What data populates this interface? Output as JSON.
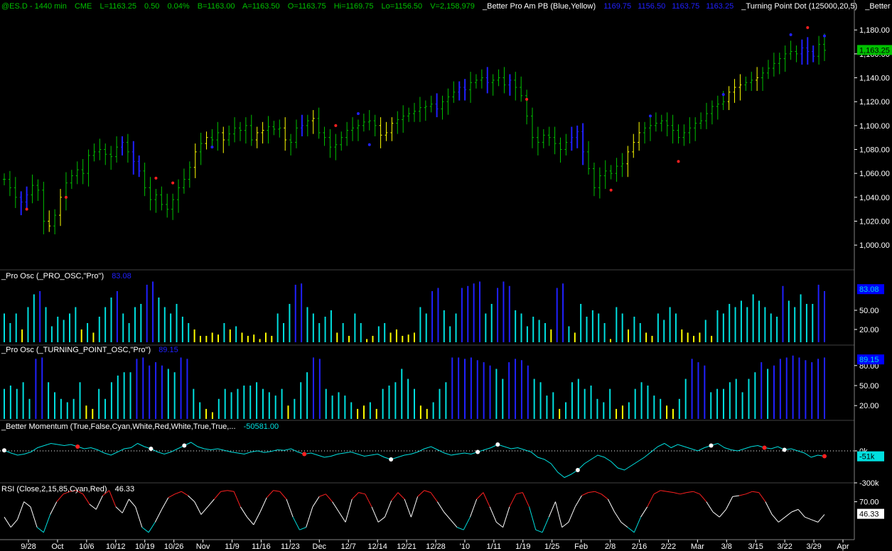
{
  "header": {
    "symbol": "@ES.D - 1440 min",
    "exchange": "CME",
    "last": "L=1163.25",
    "change": "0.50",
    "change_pct": "0.04%",
    "bid": "B=1163.00",
    "ask": "A=1163.50",
    "open": "O=1163.75",
    "high": "Hi=1169.75",
    "low": "Lo=1156.50",
    "volume": "V=2,158,979",
    "study1_name": "_Better Pro Am PB (Blue,Yellow)",
    "study1_values": [
      "1169.75",
      "1156.50",
      "1163.75",
      "1163.25"
    ],
    "study2_name": "_Turning Point Dot (125000,20,5)",
    "study3_name": "_Better Volum"
  },
  "panels": {
    "pro_osc_label": "_Pro Osc (_PRO_OSC,\"Pro\")",
    "pro_osc_value": "83.08",
    "tp_osc_label": "_Pro Osc (_TURNING_POINT_OSC,\"Pro\")",
    "tp_osc_value": "89.15",
    "momentum_label": "_Better Momentum (True,False,Cyan,White,Red,White,True,True,...",
    "momentum_value": "-50581.00",
    "rsi_label": "RSI (Close,2,15,85,Cyan,Red)",
    "rsi_value": "46.33"
  },
  "price_axis": {
    "ticks": [
      "1,180.00",
      "1,160.00",
      "1,140.00",
      "1,120.00",
      "1,100.00",
      "1,080.00",
      "1,060.00",
      "1,040.00",
      "1,020.00",
      "1,000.00"
    ],
    "last_tag": "1,163.25",
    "pro_ticks": [
      "50.00",
      "20.00"
    ],
    "pro_tag": "83.08",
    "tp_ticks": [
      "80.00",
      "50.00",
      "20.00"
    ],
    "tp_tag": "89.15",
    "mom_ticks": [
      "0k",
      "-300k"
    ],
    "mom_tag": "-51k",
    "rsi_ticks": [
      "70.00"
    ],
    "rsi_tag": "46.33"
  },
  "x_axis": {
    "labels": [
      "9/28",
      "Oct",
      "10/6",
      "10/12",
      "10/19",
      "10/26",
      "Nov",
      "11/9",
      "11/16",
      "11/23",
      "Dec",
      "12/7",
      "12/14",
      "12/21",
      "12/28",
      "'10",
      "1/11",
      "1/19",
      "1/25",
      "Feb",
      "2/8",
      "2/16",
      "2/22",
      "Mar",
      "3/8",
      "3/15",
      "3/22",
      "3/29",
      "Apr"
    ]
  },
  "colors": {
    "background": "#000000",
    "up_bar": "#00c000",
    "pro_bar": "#2020ff",
    "pullback_bar": "#ffff00",
    "dot_red": "#ff2020",
    "dot_blue": "#2020ff",
    "cyan": "#00e0e0",
    "white": "#ffffff",
    "red": "#ff2020",
    "axis_text": "#ffffff",
    "tag_green": "#00c000",
    "tag_blue": "#0000ff",
    "tag_cyan": "#00e0e0"
  },
  "chart_data": {
    "type": "bar",
    "price_range": [
      990,
      1192
    ],
    "closes": [
      1055,
      1048,
      1040,
      1036,
      1042,
      1050,
      1046,
      1020,
      1016,
      1025,
      1040,
      1052,
      1058,
      1063,
      1060,
      1075,
      1078,
      1080,
      1076,
      1074,
      1082,
      1086,
      1078,
      1070,
      1062,
      1048,
      1038,
      1042,
      1034,
      1030,
      1038,
      1048,
      1055,
      1065,
      1078,
      1085,
      1090,
      1088,
      1094,
      1088,
      1093,
      1098,
      1096,
      1100,
      1088,
      1094,
      1096,
      1099,
      1097,
      1098,
      1088,
      1086,
      1098,
      1100,
      1104,
      1106,
      1094,
      1090,
      1082,
      1084,
      1090,
      1096,
      1098,
      1100,
      1103,
      1104,
      1100,
      1092,
      1094,
      1102,
      1105,
      1108,
      1110,
      1112,
      1115,
      1116,
      1118,
      1114,
      1120,
      1124,
      1128,
      1132,
      1130,
      1136,
      1138,
      1140,
      1136,
      1138,
      1140,
      1134,
      1138,
      1132,
      1125,
      1108,
      1090,
      1086,
      1092,
      1090,
      1085,
      1080,
      1086,
      1090,
      1095,
      1078,
      1064,
      1048,
      1058,
      1062,
      1060,
      1066,
      1068,
      1078,
      1086,
      1094,
      1098,
      1100,
      1102,
      1104,
      1100,
      1096,
      1090,
      1094,
      1098,
      1102,
      1104,
      1110,
      1116,
      1118,
      1120,
      1128,
      1132,
      1134,
      1136,
      1138,
      1140,
      1144,
      1148,
      1152,
      1156,
      1160,
      1162,
      1160,
      1165,
      1162,
      1158,
      1168,
      1163
    ],
    "bar_colors": "gggbbgggygyggggggggggbgbbgggggggggygyggygggggyygggyggbgygggggggggggyyygggggggbgggbbgggbgggbggggggggggbbbgggggggyyygggggggggggggggyyyggygggggggbbb",
    "pro_osc": [
      45,
      30,
      45,
      20,
      55,
      75,
      80,
      55,
      25,
      40,
      35,
      45,
      55,
      20,
      30,
      15,
      40,
      55,
      70,
      80,
      45,
      30,
      55,
      60,
      90,
      95,
      70,
      55,
      45,
      60,
      40,
      30,
      20,
      10,
      10,
      15,
      12,
      30,
      20,
      25,
      15,
      10,
      12,
      5,
      15,
      10,
      45,
      30,
      60,
      90,
      92,
      55,
      45,
      30,
      40,
      50,
      15,
      30,
      10,
      45,
      30,
      5,
      10,
      25,
      30,
      15,
      20,
      10,
      12,
      15,
      55,
      45,
      80,
      85,
      50,
      25,
      45,
      85,
      88,
      92,
      95,
      45,
      60,
      85,
      95,
      88,
      50,
      45,
      25,
      40,
      35,
      30,
      20,
      85,
      92,
      25,
      15,
      60,
      40,
      50,
      45,
      30,
      5,
      55,
      45,
      20,
      40,
      30,
      15,
      10,
      45,
      35,
      55,
      45,
      20,
      15,
      10,
      15,
      35,
      10,
      50,
      45,
      60,
      55,
      65,
      55,
      75,
      65,
      55,
      45,
      40,
      88,
      65,
      55,
      75,
      60,
      60,
      90,
      80
    ],
    "tp_osc": [
      45,
      50,
      45,
      55,
      30,
      90,
      92,
      55,
      40,
      30,
      25,
      30,
      55,
      20,
      15,
      45,
      30,
      55,
      65,
      70,
      70,
      90,
      92,
      80,
      85,
      80,
      75,
      70,
      92,
      90,
      45,
      25,
      15,
      10,
      30,
      45,
      40,
      45,
      50,
      50,
      55,
      45,
      40,
      35,
      45,
      20,
      30,
      55,
      70,
      92,
      90,
      45,
      35,
      40,
      35,
      25,
      15,
      20,
      25,
      15,
      45,
      50,
      55,
      75,
      60,
      45,
      20,
      15,
      25,
      45,
      55,
      92,
      92,
      90,
      92,
      88,
      85,
      80,
      75,
      60,
      85,
      90,
      88,
      80,
      60,
      55,
      35,
      40,
      15,
      25,
      55,
      60,
      45,
      50,
      30,
      25,
      45,
      15,
      20,
      25,
      45,
      55,
      50,
      35,
      30,
      20,
      15,
      30,
      60,
      90,
      85,
      80,
      40,
      45,
      45,
      55,
      60,
      40,
      60,
      70,
      85,
      75,
      80,
      90,
      92,
      95,
      92,
      88,
      85,
      90,
      92
    ],
    "momentum": [
      5,
      -20,
      -40,
      -30,
      -10,
      30,
      50,
      70,
      60,
      50,
      60,
      40,
      20,
      30,
      10,
      -20,
      -40,
      -10,
      20,
      30,
      70,
      40,
      20,
      -10,
      -30,
      -10,
      20,
      50,
      80,
      40,
      20,
      10,
      20,
      5,
      -10,
      -20,
      -30,
      -10,
      0,
      -15,
      -5,
      10,
      5,
      20,
      -10,
      -30,
      -20,
      -40,
      -60,
      -50,
      -30,
      -20,
      -10,
      -30,
      -50,
      -40,
      -30,
      -60,
      -80,
      -60,
      -40,
      -30,
      -10,
      20,
      40,
      10,
      -20,
      -40,
      -30,
      -20,
      -30,
      -10,
      10,
      30,
      60,
      40,
      20,
      30,
      10,
      -10,
      -60,
      -80,
      -120,
      -200,
      -250,
      -220,
      -180,
      -120,
      -80,
      -40,
      -60,
      -100,
      -160,
      -180,
      -140,
      -100,
      -60,
      -10,
      40,
      70,
      30,
      60,
      40,
      20,
      0,
      30,
      50,
      70,
      30,
      10,
      0,
      20,
      40,
      50,
      30,
      20,
      40,
      10,
      20,
      0,
      -20,
      -60,
      -40,
      -50
    ],
    "rsi": [
      40,
      20,
      35,
      70,
      60,
      20,
      10,
      45,
      70,
      85,
      90,
      92,
      85,
      65,
      55,
      82,
      92,
      60,
      48,
      75,
      60,
      20,
      10,
      30,
      55,
      78,
      85,
      90,
      82,
      70,
      45,
      60,
      75,
      90,
      92,
      90,
      60,
      40,
      25,
      50,
      78,
      92,
      90,
      75,
      40,
      15,
      20,
      60,
      80,
      85,
      70,
      50,
      30,
      75,
      88,
      85,
      60,
      30,
      40,
      72,
      88,
      75,
      40,
      80,
      92,
      88,
      70,
      50,
      35,
      20,
      15,
      40,
      75,
      88,
      60,
      30,
      20,
      60,
      85,
      88,
      60,
      15,
      10,
      40,
      70,
      20,
      30,
      60,
      82,
      88,
      90,
      85,
      75,
      50,
      30,
      20,
      10,
      40,
      60,
      85,
      92,
      90,
      88,
      85,
      88,
      90,
      85,
      70,
      50,
      40,
      55,
      80,
      82,
      85,
      90,
      88,
      70,
      45,
      30,
      40,
      50,
      55,
      40,
      35,
      30,
      45
    ]
  }
}
